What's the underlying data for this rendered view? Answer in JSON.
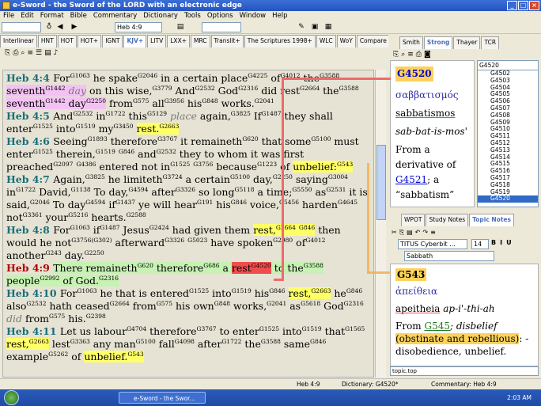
{
  "window": {
    "title": "e-Sword - the Sword of the LORD with an electronic edge"
  },
  "menu": [
    "File",
    "Edit",
    "Format",
    "Bible",
    "Commentary",
    "Dictionary",
    "Tools",
    "Options",
    "Window",
    "Help"
  ],
  "toolbar": {
    "verse_combo": "Heb 4:9"
  },
  "bible_tabs": [
    "Interlinear",
    "HNT",
    "HOT",
    "HOT+",
    "IGNT",
    "KJV+",
    "LITV",
    "LXX+",
    "MRC",
    "Translit+",
    "The Scriptures 1998+",
    "WLC",
    "WoY",
    "Compare",
    "Paral"
  ],
  "bible_active_tab": "KJV+",
  "dict_tabs": [
    "Smith",
    "Strong",
    "Thayer",
    "TCR"
  ],
  "dict_active_tab": "Strong",
  "topic_tabs": [
    "WPOT",
    "Study Notes",
    "Topic Notes"
  ],
  "topic_active_tab": "Topic Notes",
  "editor": {
    "font": "TITUS Cyberbit ...",
    "size": "14",
    "style": "Sabbath"
  },
  "verses": [
    {
      "ref": "Heb 4:4",
      "html": "For<sup>G1063</sup> he spake<sup>G2046</sup> in a certain place<sup>G4225</sup> of<sup>G4012</sup> the<sup>G3588</sup> <span class='mag'>seventh<sup>G1442</sup> <span class='ital'>day</span></span> on this wise,<sup>G3779</sup> And<sup>G2532</sup> God<sup>G2316</sup> did rest<sup>G2664</sup> the<sup>G3588</sup> <span class='mag'>seventh<sup>G1442</sup> day<sup>G2250</sup></span> from<sup>G575</sup> all<sup>G3956</sup> his<sup>G848</sup> works.<sup>G2041</sup>"
    },
    {
      "ref": "Heb 4:5",
      "html": "And<sup>G2532</sup> in<sup>G1722</sup> this<sup>G5129</sup> <span class='ital'>place</span> again,<sup>G3825</sup> If<sup>G1487</sup> they shall enter<sup>G1525</sup> into<sup>G1519</sup> my<sup>G3450</sup> <span class='hl-rest'>rest.<sup>G2663</sup></span>"
    },
    {
      "ref": "Heb 4:6",
      "html": "Seeing<sup>G1893</sup> therefore<sup>G3767</sup> it remaineth<sup>G620</sup> that some<sup>G5100</sup> must enter<sup>G1525</sup> therein,<sup>G1519</sup> <sup>G846</sup> and<sup>G2532</sup> they to whom it was first preached<sup>G2097</sup> <sup>G4386</sup> entered not in<sup>G1525</sup> <sup>G3756</sup> because<sup>G1223</sup> of <span class='hl-unbelief'>unbelief:<sup>G543</sup></span>"
    },
    {
      "ref": "Heb 4:7",
      "html": "Again,<sup>G3825</sup> he limiteth<sup>G3724</sup> a certain<sup>G5100</sup> day,<sup>G2250</sup> saying<sup>G3004</sup> in<sup>G1722</sup> David,<sup>G1138</sup> To day,<sup>G4594</sup> after<sup>G3326</sup> so long<sup>G5118</sup> a time;<sup>G5550</sup> as<sup>G2531</sup> it is said,<sup>G2046</sup> To day<sup>G4594</sup> if<sup>G1437</sup> ye will hear<sup>G191</sup> his<sup>G846</sup> voice,<sup>G5456</sup> harden<sup>G4645</sup> not<sup>G3361</sup> your<sup>G5216</sup> hearts.<sup>G2588</sup>"
    },
    {
      "ref": "Heb 4:8",
      "html": "For<sup>G1063</sup> if<sup>G1487</sup> Jesus<sup>G2424</sup> had given them <span class='hl-rest'>rest,<sup>G2664</sup> <sup>G846</sup></span> then would he not<sup>G3756(G302)</sup> afterward<sup>G3326</sup> <sup>G5023</sup> have spoken<sup>G2980</sup> of<sup>G4012</sup> another<sup>G243</sup> day.<sup>G2250</sup>"
    },
    {
      "ref": "Heb 4:9",
      "current": true,
      "html": "<span class='curverse'>There remaineth<sup>G620</sup> therefore<sup>G686</sup> a <span class='redbox'>rest<sup>G4520</sup></span> to the<sup>G3588</sup> people<sup>G2992</sup> of God.<sup>G2316</sup></span>"
    },
    {
      "ref": "Heb 4:10",
      "html": "For<sup>G1063</sup> he that is entered<sup>G1525</sup> into<sup>G1519</sup> his<sup>G846</sup> <span class='hl-rest'>rest,<sup>G2663</sup></span> he<sup>G846</sup> also<sup>G2532</sup> hath ceased<sup>G2664</sup> from<sup>G575</sup> his own<sup>G848</sup> works,<sup>G2041</sup> as<sup>G5618</sup> God<sup>G2316</sup> <span class='ital'>did</span> from<sup>G575</sup> his.<sup>G2398</sup>"
    },
    {
      "ref": "Heb 4:11",
      "html": "Let us labour<sup>G4704</sup> therefore<sup>G3767</sup> to enter<sup>G1525</sup> into<sup>G1519</sup> that<sup>G1565</sup> <span class='hl-rest'>rest,<sup>G2663</sup></span> lest<sup>G3363</sup> any man<sup>G5100</sup> fall<sup>G4098</sup> after<sup>G1722</sup> the<sup>G3588</sup> same<sup>G846</sup> example<sup>G5262</sup> of <span class='hl-unbelief'>unbelief.<sup>G543</sup></span>"
    }
  ],
  "dictionary": {
    "number": "G4520",
    "greek": "σαββατισμός",
    "translit": "sabbatismos",
    "pron": "sab-bat-is-mos'",
    "def_pre": "From a derivative of ",
    "def_link": "G4521",
    "def_post": "; a “sabbatism”"
  },
  "strong_input": "G4520",
  "strong_list": [
    "G4502",
    "G4503",
    "G4504",
    "G4505",
    "G4506",
    "G4507",
    "G4508",
    "G4509",
    "G4510",
    "G4511",
    "G4512",
    "G4513",
    "G4514",
    "G4515",
    "G4516",
    "G4517",
    "G4518",
    "G4519",
    "G4520"
  ],
  "strong_selected": "G4520",
  "topic": {
    "number": "G543",
    "greek": "ἀπείθεια",
    "translit": "apeitheia",
    "pron": "ap-i'-thi-ah",
    "from_label": "From ",
    "from_link": "G545",
    "def1": "; disbelief",
    "def_hl": "(obstinate and rebellious)",
    "def2": ": - disobedience, unbelief.",
    "bar": "topic.top"
  },
  "status": {
    "verse": "Heb 4:9",
    "dictionary": "Dictionary: G4520*",
    "commentary": "Commentary: Heb 4:9"
  },
  "taskbar": {
    "app": "e-Sword - the Swor...",
    "clock": "2:03 AM"
  }
}
